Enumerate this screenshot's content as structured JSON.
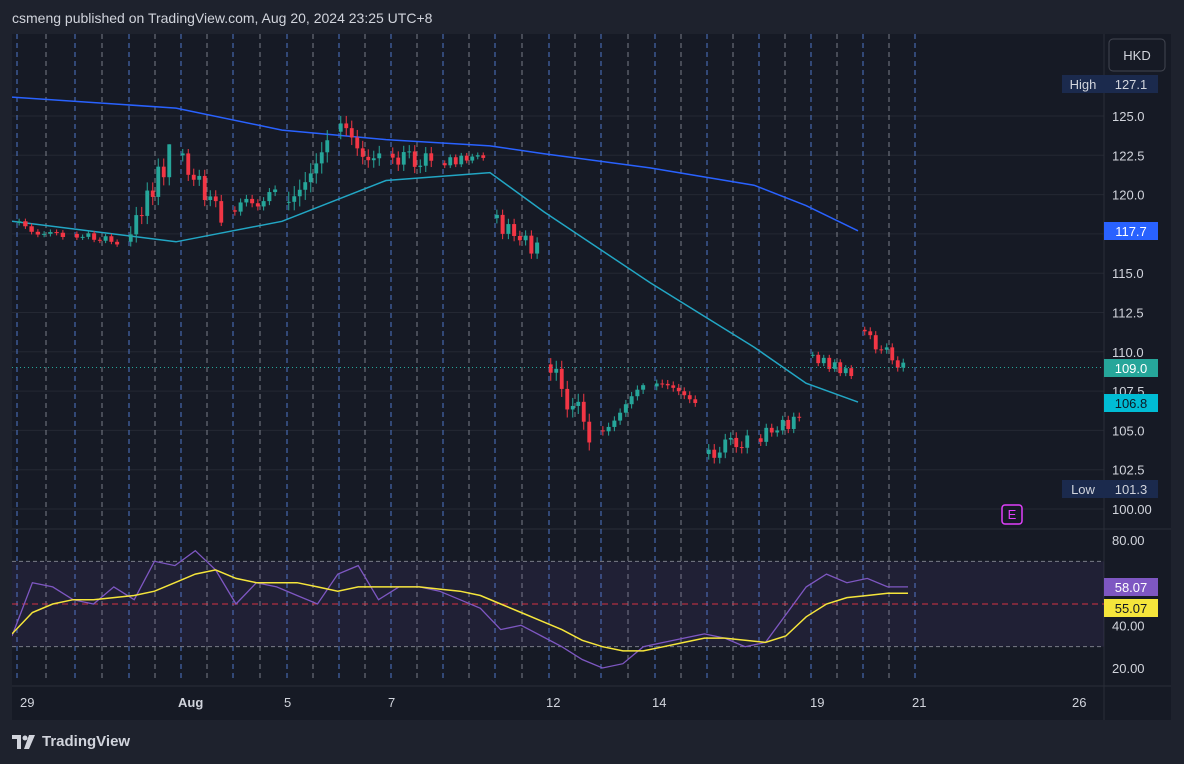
{
  "header": {
    "attribution": "csmeng published on TradingView.com, Aug 20, 2024 23:25 UTC+8"
  },
  "footer": {
    "brand": "TradingView"
  },
  "colors": {
    "up": "#26a69a",
    "down": "#f23645",
    "ma_slow": "#2962ff",
    "ma_fast": "#22a6c4",
    "rsi": "#7e57c2",
    "rsi_ma": "#f5e53b",
    "event": "#e040fb"
  },
  "chart_data": [
    {
      "type": "candlestick",
      "currency": "HKD",
      "x_tick_labels": [
        "29",
        "Aug",
        "5",
        "7",
        "12",
        "14",
        "19",
        "21",
        "26"
      ],
      "y_ticks": [
        100.0,
        102.5,
        105.0,
        107.5,
        110.0,
        112.5,
        115.0,
        117.5,
        120.0,
        122.5,
        125.0
      ],
      "y_tick_labels": [
        "100.00",
        "102.5",
        "105.0",
        "107.5",
        "110.0",
        "112.5",
        "115.0",
        "117.5",
        "120.0",
        "122.5",
        "125.0"
      ],
      "ylim": [
        99.0,
        129.8
      ],
      "grid": true,
      "price_labels": {
        "high": {
          "label": "High",
          "value": "127.1"
        },
        "low": {
          "label": "Low",
          "value": "101.3"
        },
        "last": {
          "value": "109.0"
        },
        "ma_slow_value": {
          "value": "117.7"
        },
        "ma_fast_value": {
          "value": "106.8"
        }
      },
      "event_marker": {
        "label": "E"
      },
      "daily_sessions": [
        {
          "date": "Jul 29",
          "open": 118.2,
          "high": 118.9,
          "low": 116.8,
          "close": 117.2
        },
        {
          "date": "Jul 30",
          "open": 117.5,
          "high": 118.2,
          "low": 116.3,
          "close": 117.0
        },
        {
          "date": "Jul 31",
          "open": 117.0,
          "high": 123.2,
          "low": 116.7,
          "close": 122.5
        },
        {
          "date": "Aug 1",
          "open": 122.5,
          "high": 122.9,
          "low": 118.0,
          "close": 118.8
        },
        {
          "date": "Aug 2",
          "open": 119.0,
          "high": 121.8,
          "low": 118.6,
          "close": 120.0
        },
        {
          "date": "Aug 5",
          "open": 119.5,
          "high": 127.1,
          "low": 119.0,
          "close": 124.0
        },
        {
          "date": "Aug 6",
          "open": 124.0,
          "high": 127.0,
          "low": 121.0,
          "close": 122.5
        },
        {
          "date": "Aug 7",
          "open": 122.6,
          "high": 125.3,
          "low": 120.3,
          "close": 122.0
        },
        {
          "date": "Aug 8",
          "open": 122.0,
          "high": 123.5,
          "low": 121.3,
          "close": 122.5
        },
        {
          "date": "Aug 9",
          "open": 118.5,
          "high": 119.2,
          "low": 115.0,
          "close": 116.5
        },
        {
          "date": "Aug 12",
          "open": 109.2,
          "high": 109.6,
          "low": 103.2,
          "close": 105.0
        },
        {
          "date": "Aug 13",
          "open": 105.0,
          "high": 108.0,
          "low": 104.6,
          "close": 107.5
        },
        {
          "date": "Aug 14",
          "open": 107.8,
          "high": 109.6,
          "low": 106.5,
          "close": 107.0
        },
        {
          "date": "Aug 15",
          "open": 103.5,
          "high": 105.8,
          "low": 101.3,
          "close": 104.5
        },
        {
          "date": "Aug 16",
          "open": 104.5,
          "high": 106.3,
          "low": 103.0,
          "close": 105.8
        },
        {
          "date": "Aug 19",
          "open": 109.8,
          "high": 110.3,
          "low": 107.9,
          "close": 108.6
        },
        {
          "date": "Aug 20",
          "open": 111.4,
          "high": 111.6,
          "low": 108.4,
          "close": 109.0
        }
      ],
      "ma_slow": [
        {
          "date": "Jul 29",
          "value": 126.2
        },
        {
          "date": "Aug 1",
          "value": 125.5
        },
        {
          "date": "Aug 5",
          "value": 124.1
        },
        {
          "date": "Aug 7",
          "value": 123.5
        },
        {
          "date": "Aug 9",
          "value": 123.1
        },
        {
          "date": "Aug 12",
          "value": 122.6
        },
        {
          "date": "Aug 14",
          "value": 121.7
        },
        {
          "date": "Aug 16",
          "value": 120.6
        },
        {
          "date": "Aug 19",
          "value": 119.3
        },
        {
          "date": "Aug 20",
          "value": 117.7
        }
      ],
      "ma_fast": [
        {
          "date": "Jul 29",
          "value": 118.3
        },
        {
          "date": "Aug 1",
          "value": 117.0
        },
        {
          "date": "Aug 5",
          "value": 118.3
        },
        {
          "date": "Aug 7",
          "value": 120.9
        },
        {
          "date": "Aug 9",
          "value": 121.4
        },
        {
          "date": "Aug 12",
          "value": 118.9
        },
        {
          "date": "Aug 14",
          "value": 114.4
        },
        {
          "date": "Aug 16",
          "value": 110.3
        },
        {
          "date": "Aug 19",
          "value": 108.0
        },
        {
          "date": "Aug 20",
          "value": 106.8
        }
      ]
    },
    {
      "type": "line",
      "y_ticks": [
        20.0,
        40.0,
        80.0
      ],
      "y_tick_labels": [
        "20.00",
        "40.00",
        "80.00"
      ],
      "ylim": [
        15.0,
        84.0
      ],
      "band": {
        "upper": 70,
        "lower": 30,
        "mid": 50
      },
      "value_labels": {
        "rsi": "58.07",
        "rsi_ma": "55.07"
      },
      "series": [
        {
          "values": [
            35,
            60,
            58,
            52,
            50,
            58,
            52,
            70,
            68,
            75,
            66,
            50,
            60,
            58,
            54,
            50,
            64,
            68,
            52,
            58,
            58,
            56,
            52,
            48,
            38,
            40,
            35,
            30,
            24,
            20,
            22,
            30,
            32,
            34,
            36,
            34,
            30,
            32,
            45,
            58,
            64,
            60,
            62,
            58,
            58
          ]
        },
        {
          "values": [
            36,
            46,
            50,
            52,
            52,
            53,
            54,
            56,
            60,
            64,
            66,
            62,
            60,
            60,
            60,
            58,
            56,
            58,
            58,
            58,
            58,
            57,
            56,
            54,
            50,
            46,
            42,
            38,
            33,
            30,
            28,
            28,
            30,
            32,
            34,
            34,
            33,
            32,
            35,
            44,
            50,
            53,
            54,
            55,
            55
          ]
        }
      ]
    }
  ]
}
